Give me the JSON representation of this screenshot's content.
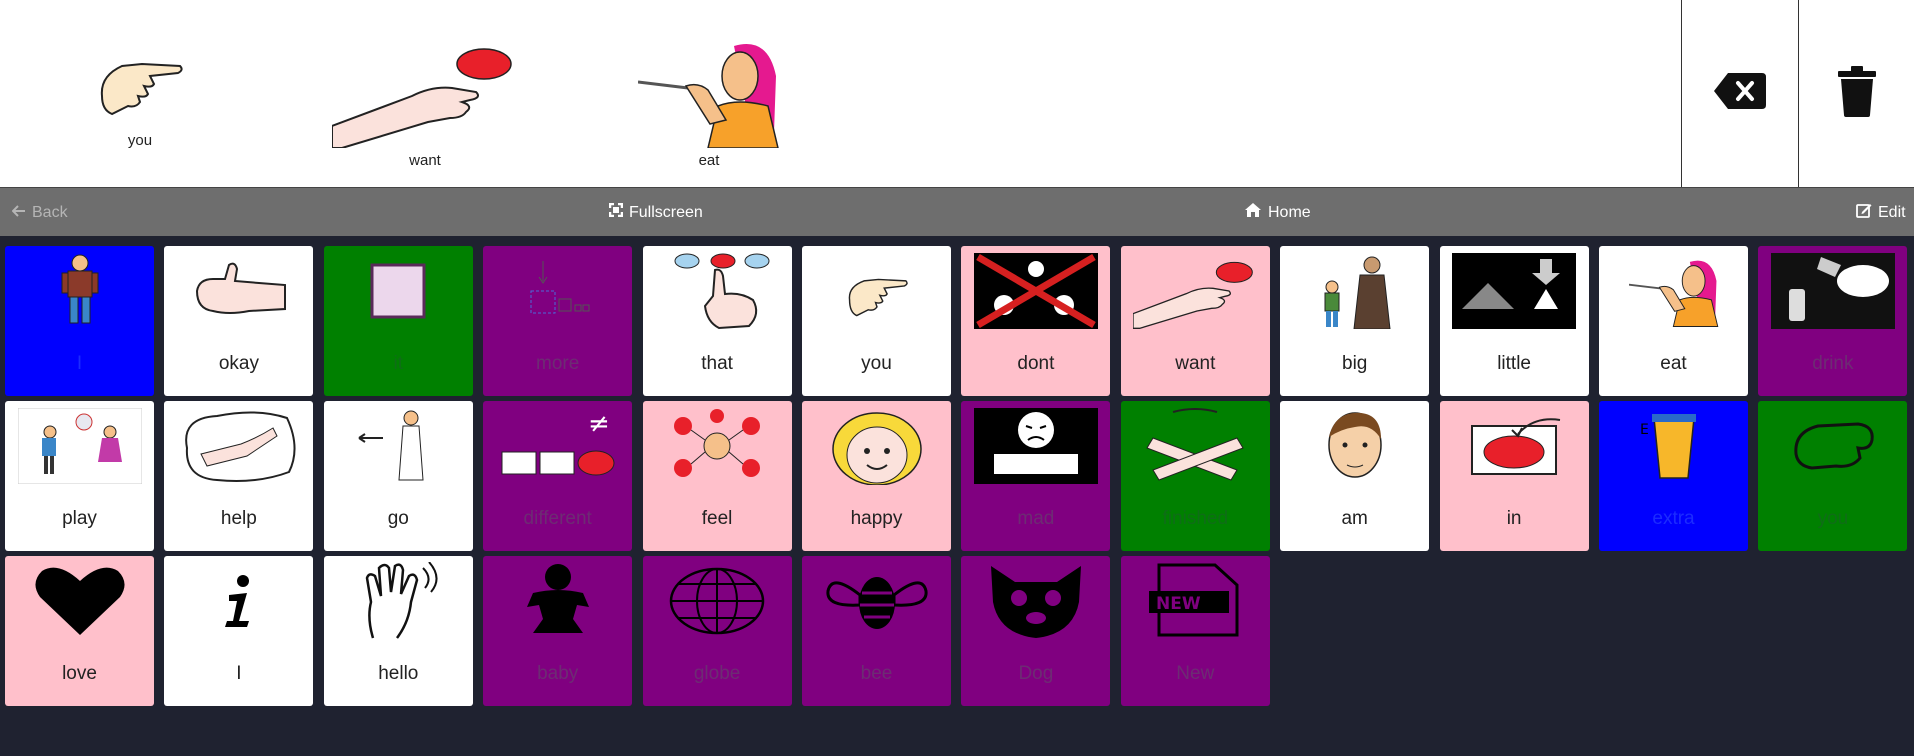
{
  "sentence": {
    "words": [
      {
        "label": "you",
        "icon": "pointing-hand-icon"
      },
      {
        "label": "want",
        "icon": "hand-reaching-ball-icon"
      },
      {
        "label": "eat",
        "icon": "person-eating-icon"
      }
    ]
  },
  "toolbar": {
    "backspace_icon": "backspace-icon",
    "clear_icon": "trash-icon"
  },
  "nav": {
    "back_label": "Back",
    "fullscreen_label": "Fullscreen",
    "home_label": "Home",
    "edit_label": "Edit"
  },
  "colors": {
    "white": "#ffffff",
    "pink": "#ffc0cb",
    "blue": "#0000ff",
    "green": "#008000",
    "purple": "#800080"
  },
  "tiles": [
    {
      "label": "I",
      "color": "blue",
      "icon": "person-icon"
    },
    {
      "label": "okay",
      "color": "white",
      "icon": "thumbs-up-icon"
    },
    {
      "label": "it",
      "color": "green",
      "icon": "square-icon"
    },
    {
      "label": "more",
      "color": "purple",
      "icon": "more-boxes-icon"
    },
    {
      "label": "that",
      "color": "white",
      "icon": "pointing-finger-dots-icon"
    },
    {
      "label": "you",
      "color": "white",
      "icon": "pointing-hand-icon"
    },
    {
      "label": "dont",
      "color": "pink",
      "icon": "crossed-faces-icon"
    },
    {
      "label": "want",
      "color": "pink",
      "icon": "hand-reaching-ball-icon"
    },
    {
      "label": "big",
      "color": "white",
      "icon": "adult-and-child-icon"
    },
    {
      "label": "little",
      "color": "white",
      "icon": "small-triangle-icon"
    },
    {
      "label": "eat",
      "color": "white",
      "icon": "person-eating-icon"
    },
    {
      "label": "drink",
      "color": "purple",
      "icon": "pouring-drink-icon"
    },
    {
      "label": "play",
      "color": "white",
      "icon": "children-playing-icon"
    },
    {
      "label": "help",
      "color": "white",
      "icon": "helping-hands-icon"
    },
    {
      "label": "go",
      "color": "white",
      "icon": "person-walking-icon"
    },
    {
      "label": "different",
      "color": "purple",
      "icon": "not-equal-boxes-icon"
    },
    {
      "label": "feel",
      "color": "pink",
      "icon": "feelings-face-icon"
    },
    {
      "label": "happy",
      "color": "pink",
      "icon": "happy-face-icon"
    },
    {
      "label": "mad",
      "color": "purple",
      "icon": "mad-face-icon"
    },
    {
      "label": "finished",
      "color": "green",
      "icon": "crossed-hands-icon"
    },
    {
      "label": "am",
      "color": "white",
      "icon": "man-face-icon"
    },
    {
      "label": "in",
      "color": "pink",
      "icon": "ball-into-box-icon"
    },
    {
      "label": "extra",
      "color": "blue",
      "icon": "cup-icon"
    },
    {
      "label": "you",
      "color": "green",
      "icon": "pointing-fist-icon"
    },
    {
      "label": "love",
      "color": "pink",
      "icon": "heart-icon"
    },
    {
      "label": "I",
      "color": "white",
      "icon": "info-icon"
    },
    {
      "label": "hello",
      "color": "white",
      "icon": "waving-hand-icon"
    },
    {
      "label": "baby",
      "color": "purple",
      "icon": "baby-icon"
    },
    {
      "label": "globe",
      "color": "purple",
      "icon": "globe-icon"
    },
    {
      "label": "bee",
      "color": "purple",
      "icon": "bee-icon"
    },
    {
      "label": "Dog",
      "color": "purple",
      "icon": "dog-face-icon"
    },
    {
      "label": "New",
      "color": "purple",
      "icon": "new-document-icon"
    }
  ]
}
